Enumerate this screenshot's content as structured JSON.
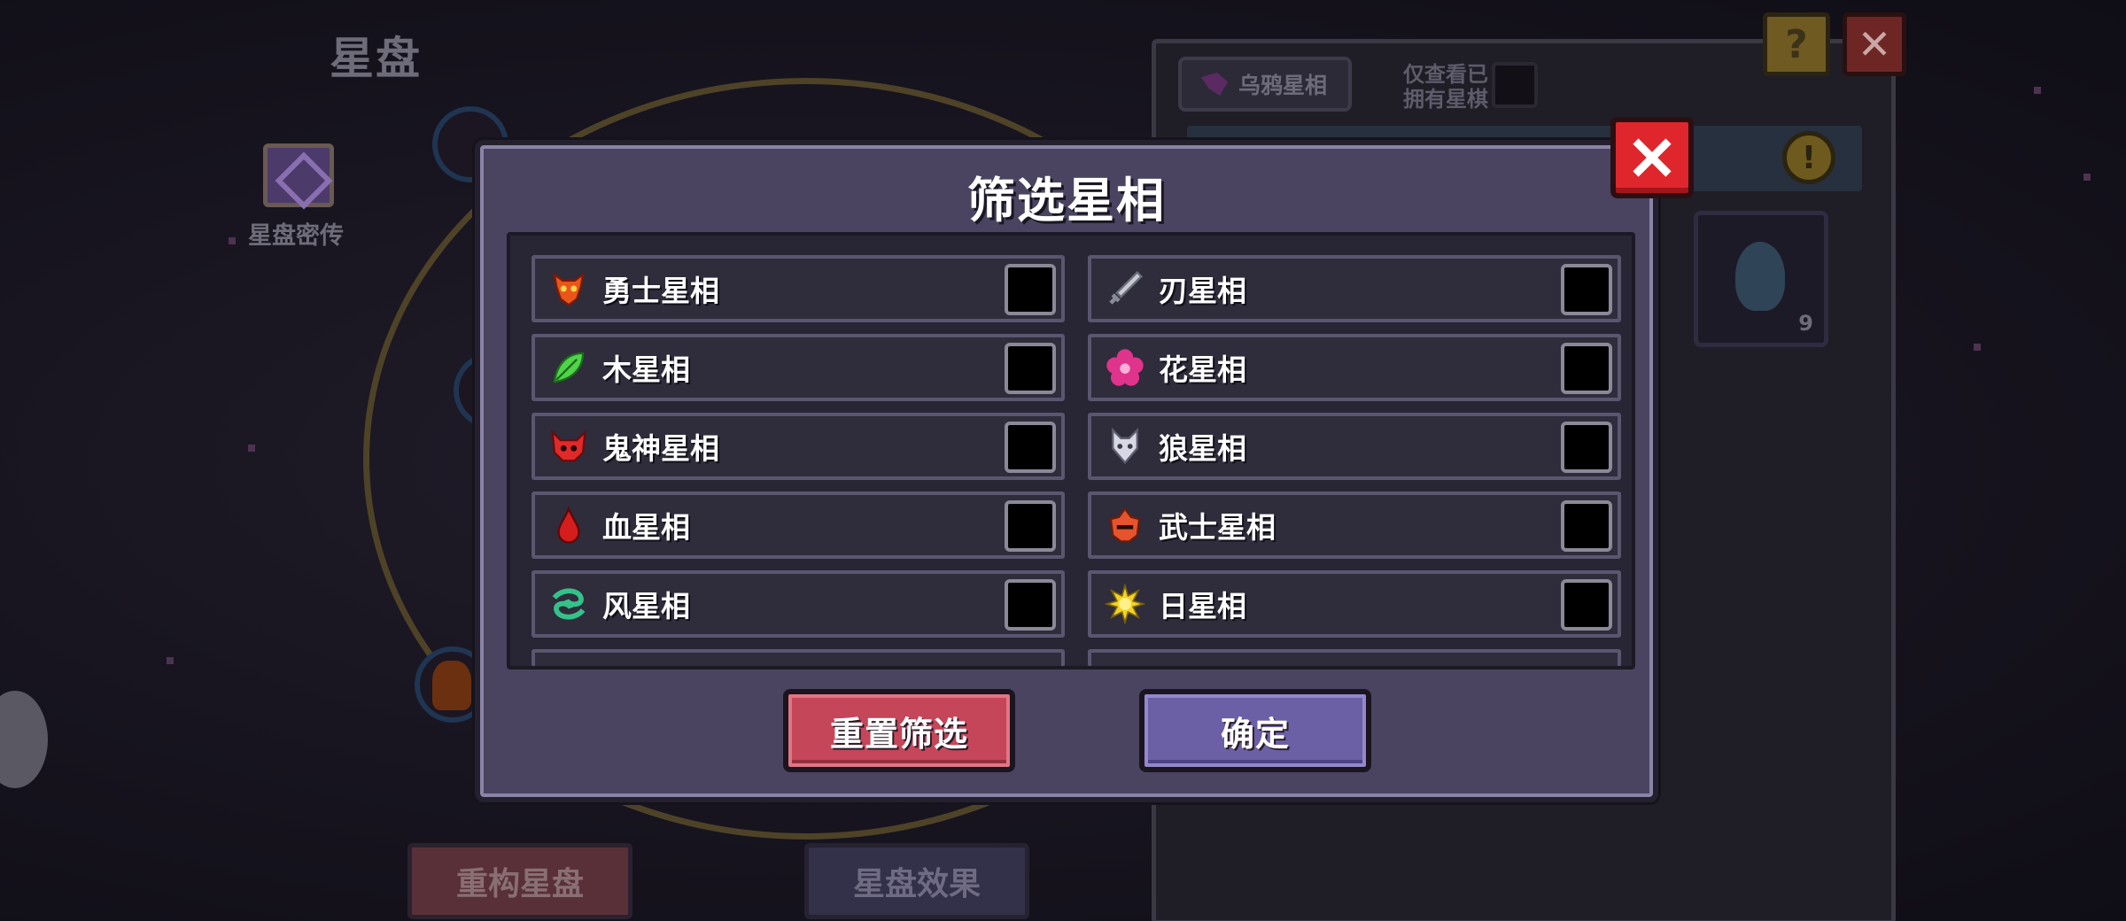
{
  "background": {
    "title": "星盘",
    "secret_label": "星盘密传",
    "rebuild_label": "重构星盘",
    "effect_label": "星盘效果",
    "crow_label": "乌鸦星相",
    "owned_line1": "仅查看已",
    "owned_line2": "拥有星棋",
    "help_label": "?",
    "close_label": "✕",
    "warn_label": "!",
    "card_count": "9"
  },
  "modal": {
    "title": "筛选星相",
    "reset_label": "重置筛选",
    "confirm_label": "确定"
  },
  "filters": [
    {
      "label": "勇士星相",
      "icon": "warrior-icon",
      "checked": false
    },
    {
      "label": "刃星相",
      "icon": "blade-icon",
      "checked": false
    },
    {
      "label": "木星相",
      "icon": "leaf-icon",
      "checked": false
    },
    {
      "label": "花星相",
      "icon": "flower-icon",
      "checked": false
    },
    {
      "label": "鬼神星相",
      "icon": "demon-icon",
      "checked": false
    },
    {
      "label": "狼星相",
      "icon": "wolf-icon",
      "checked": false
    },
    {
      "label": "血星相",
      "icon": "blood-drop-icon",
      "checked": false
    },
    {
      "label": "武士星相",
      "icon": "samurai-icon",
      "checked": false
    },
    {
      "label": "风星相",
      "icon": "wind-icon",
      "checked": false
    },
    {
      "label": "日星相",
      "icon": "sun-icon",
      "checked": false
    }
  ],
  "colors": {
    "warrior": "#e8561a",
    "blade": "#c9c9d4",
    "leaf": "#4fd44a",
    "flower": "#e0338c",
    "demon": "#e02a2a",
    "wolf": "#d8d8e4",
    "blood": "#d41e1e",
    "samurai": "#e5542c",
    "wind": "#34c28a",
    "sun": "#f2d224",
    "reset_button": "#c54659",
    "confirm_button": "#6b5fa6",
    "close_button": "#e0262d"
  }
}
